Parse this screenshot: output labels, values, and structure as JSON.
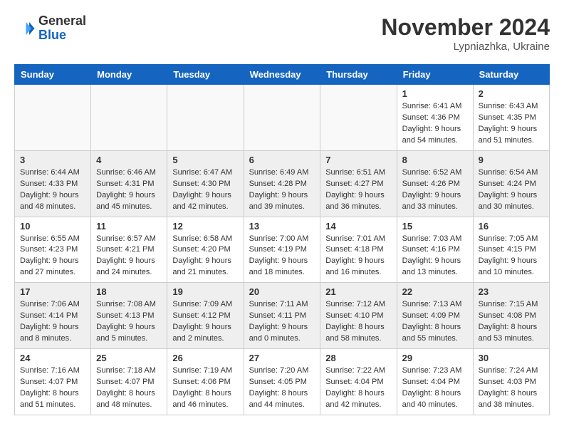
{
  "header": {
    "logo_general": "General",
    "logo_blue": "Blue",
    "month_title": "November 2024",
    "location": "Lypniazhka, Ukraine"
  },
  "days_of_week": [
    "Sunday",
    "Monday",
    "Tuesday",
    "Wednesday",
    "Thursday",
    "Friday",
    "Saturday"
  ],
  "weeks": [
    {
      "days": [
        {
          "num": "",
          "empty": true
        },
        {
          "num": "",
          "empty": true
        },
        {
          "num": "",
          "empty": true
        },
        {
          "num": "",
          "empty": true
        },
        {
          "num": "",
          "empty": true
        },
        {
          "num": "1",
          "sunrise": "Sunrise: 6:41 AM",
          "sunset": "Sunset: 4:36 PM",
          "daylight": "Daylight: 9 hours and 54 minutes."
        },
        {
          "num": "2",
          "sunrise": "Sunrise: 6:43 AM",
          "sunset": "Sunset: 4:35 PM",
          "daylight": "Daylight: 9 hours and 51 minutes."
        }
      ]
    },
    {
      "days": [
        {
          "num": "3",
          "sunrise": "Sunrise: 6:44 AM",
          "sunset": "Sunset: 4:33 PM",
          "daylight": "Daylight: 9 hours and 48 minutes."
        },
        {
          "num": "4",
          "sunrise": "Sunrise: 6:46 AM",
          "sunset": "Sunset: 4:31 PM",
          "daylight": "Daylight: 9 hours and 45 minutes."
        },
        {
          "num": "5",
          "sunrise": "Sunrise: 6:47 AM",
          "sunset": "Sunset: 4:30 PM",
          "daylight": "Daylight: 9 hours and 42 minutes."
        },
        {
          "num": "6",
          "sunrise": "Sunrise: 6:49 AM",
          "sunset": "Sunset: 4:28 PM",
          "daylight": "Daylight: 9 hours and 39 minutes."
        },
        {
          "num": "7",
          "sunrise": "Sunrise: 6:51 AM",
          "sunset": "Sunset: 4:27 PM",
          "daylight": "Daylight: 9 hours and 36 minutes."
        },
        {
          "num": "8",
          "sunrise": "Sunrise: 6:52 AM",
          "sunset": "Sunset: 4:26 PM",
          "daylight": "Daylight: 9 hours and 33 minutes."
        },
        {
          "num": "9",
          "sunrise": "Sunrise: 6:54 AM",
          "sunset": "Sunset: 4:24 PM",
          "daylight": "Daylight: 9 hours and 30 minutes."
        }
      ]
    },
    {
      "days": [
        {
          "num": "10",
          "sunrise": "Sunrise: 6:55 AM",
          "sunset": "Sunset: 4:23 PM",
          "daylight": "Daylight: 9 hours and 27 minutes."
        },
        {
          "num": "11",
          "sunrise": "Sunrise: 6:57 AM",
          "sunset": "Sunset: 4:21 PM",
          "daylight": "Daylight: 9 hours and 24 minutes."
        },
        {
          "num": "12",
          "sunrise": "Sunrise: 6:58 AM",
          "sunset": "Sunset: 4:20 PM",
          "daylight": "Daylight: 9 hours and 21 minutes."
        },
        {
          "num": "13",
          "sunrise": "Sunrise: 7:00 AM",
          "sunset": "Sunset: 4:19 PM",
          "daylight": "Daylight: 9 hours and 18 minutes."
        },
        {
          "num": "14",
          "sunrise": "Sunrise: 7:01 AM",
          "sunset": "Sunset: 4:18 PM",
          "daylight": "Daylight: 9 hours and 16 minutes."
        },
        {
          "num": "15",
          "sunrise": "Sunrise: 7:03 AM",
          "sunset": "Sunset: 4:16 PM",
          "daylight": "Daylight: 9 hours and 13 minutes."
        },
        {
          "num": "16",
          "sunrise": "Sunrise: 7:05 AM",
          "sunset": "Sunset: 4:15 PM",
          "daylight": "Daylight: 9 hours and 10 minutes."
        }
      ]
    },
    {
      "days": [
        {
          "num": "17",
          "sunrise": "Sunrise: 7:06 AM",
          "sunset": "Sunset: 4:14 PM",
          "daylight": "Daylight: 9 hours and 8 minutes."
        },
        {
          "num": "18",
          "sunrise": "Sunrise: 7:08 AM",
          "sunset": "Sunset: 4:13 PM",
          "daylight": "Daylight: 9 hours and 5 minutes."
        },
        {
          "num": "19",
          "sunrise": "Sunrise: 7:09 AM",
          "sunset": "Sunset: 4:12 PM",
          "daylight": "Daylight: 9 hours and 2 minutes."
        },
        {
          "num": "20",
          "sunrise": "Sunrise: 7:11 AM",
          "sunset": "Sunset: 4:11 PM",
          "daylight": "Daylight: 9 hours and 0 minutes."
        },
        {
          "num": "21",
          "sunrise": "Sunrise: 7:12 AM",
          "sunset": "Sunset: 4:10 PM",
          "daylight": "Daylight: 8 hours and 58 minutes."
        },
        {
          "num": "22",
          "sunrise": "Sunrise: 7:13 AM",
          "sunset": "Sunset: 4:09 PM",
          "daylight": "Daylight: 8 hours and 55 minutes."
        },
        {
          "num": "23",
          "sunrise": "Sunrise: 7:15 AM",
          "sunset": "Sunset: 4:08 PM",
          "daylight": "Daylight: 8 hours and 53 minutes."
        }
      ]
    },
    {
      "days": [
        {
          "num": "24",
          "sunrise": "Sunrise: 7:16 AM",
          "sunset": "Sunset: 4:07 PM",
          "daylight": "Daylight: 8 hours and 51 minutes."
        },
        {
          "num": "25",
          "sunrise": "Sunrise: 7:18 AM",
          "sunset": "Sunset: 4:07 PM",
          "daylight": "Daylight: 8 hours and 48 minutes."
        },
        {
          "num": "26",
          "sunrise": "Sunrise: 7:19 AM",
          "sunset": "Sunset: 4:06 PM",
          "daylight": "Daylight: 8 hours and 46 minutes."
        },
        {
          "num": "27",
          "sunrise": "Sunrise: 7:20 AM",
          "sunset": "Sunset: 4:05 PM",
          "daylight": "Daylight: 8 hours and 44 minutes."
        },
        {
          "num": "28",
          "sunrise": "Sunrise: 7:22 AM",
          "sunset": "Sunset: 4:04 PM",
          "daylight": "Daylight: 8 hours and 42 minutes."
        },
        {
          "num": "29",
          "sunrise": "Sunrise: 7:23 AM",
          "sunset": "Sunset: 4:04 PM",
          "daylight": "Daylight: 8 hours and 40 minutes."
        },
        {
          "num": "30",
          "sunrise": "Sunrise: 7:24 AM",
          "sunset": "Sunset: 4:03 PM",
          "daylight": "Daylight: 8 hours and 38 minutes."
        }
      ]
    }
  ]
}
